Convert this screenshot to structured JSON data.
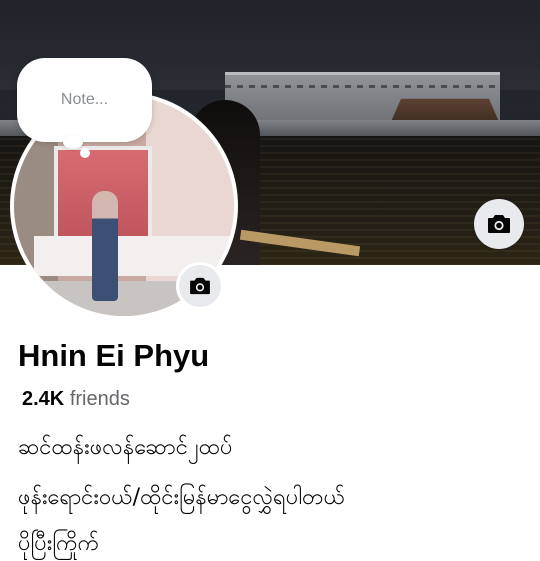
{
  "note": {
    "placeholder": "Note..."
  },
  "profile": {
    "name": "Hnin Ei Phyu",
    "friends_count": "2.4K",
    "friends_label": "friends"
  },
  "bio": {
    "line1": "ဆင်ထန်းဖလန်ဆောင်၂ထပ်",
    "line2": "ဖုန်းရောင်းဝယ်/ထိုင်းမြန်မာငွေလွှဲရပါတယ်",
    "line3": "ပိုပြီးကြိုက်"
  },
  "icons": {
    "cover_camera": "camera-icon",
    "avatar_camera": "camera-icon"
  },
  "colors": {
    "text_primary": "#050505",
    "text_secondary": "#65676b",
    "icon_bg": "#e9eaee"
  }
}
